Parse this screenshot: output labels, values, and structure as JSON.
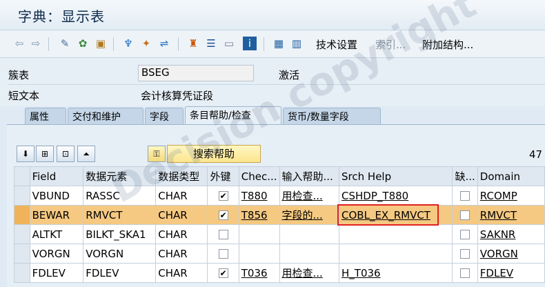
{
  "window": {
    "title": "字典：显示表"
  },
  "toolbar": {
    "tech_settings": "技术设置",
    "index": "索引...",
    "append_structure": "附加结构..."
  },
  "fields": {
    "table_label": "簇表",
    "table_value": "BSEG",
    "status": "激活",
    "short_text_label": "短文本",
    "short_text_value": "会计核算凭证段"
  },
  "tabs": [
    "属性",
    "交付和维护",
    "字段",
    "条目帮助/检查",
    "货币/数量字段"
  ],
  "panel": {
    "search_help_button": "搜索帮助",
    "count": "47"
  },
  "grid": {
    "headers": [
      "Field",
      "数据元素",
      "数据类型",
      "外键",
      "Chec...",
      "输入帮助...",
      "Srch Help",
      "缺...",
      "Domain"
    ],
    "rows": [
      {
        "field": "VBUND",
        "element": "RASSC",
        "type": "CHAR",
        "fk": true,
        "check": "T880",
        "help": "用检查...",
        "srch": "CSHDP_T880",
        "default": false,
        "domain": "RCOMP"
      },
      {
        "field": "BEWAR",
        "element": "RMVCT",
        "type": "CHAR",
        "fk": true,
        "check": "T856",
        "help": "字段的...",
        "srch": "COBL_EX_RMVCT",
        "default": false,
        "domain": "RMVCT"
      },
      {
        "field": "ALTKT",
        "element": "BILKT_SKA1",
        "type": "CHAR",
        "fk": false,
        "check": "",
        "help": "",
        "srch": "",
        "default": false,
        "domain": "SAKNR"
      },
      {
        "field": "VORGN",
        "element": "VORGN",
        "type": "CHAR",
        "fk": false,
        "check": "",
        "help": "",
        "srch": "",
        "default": false,
        "domain": "VORGN"
      },
      {
        "field": "FDLEV",
        "element": "FDLEV",
        "type": "CHAR",
        "fk": true,
        "check": "T036",
        "help": "用检查...",
        "srch": "H_T036",
        "default": false,
        "domain": "FDLEV"
      }
    ]
  },
  "watermark": "Decision copyright"
}
